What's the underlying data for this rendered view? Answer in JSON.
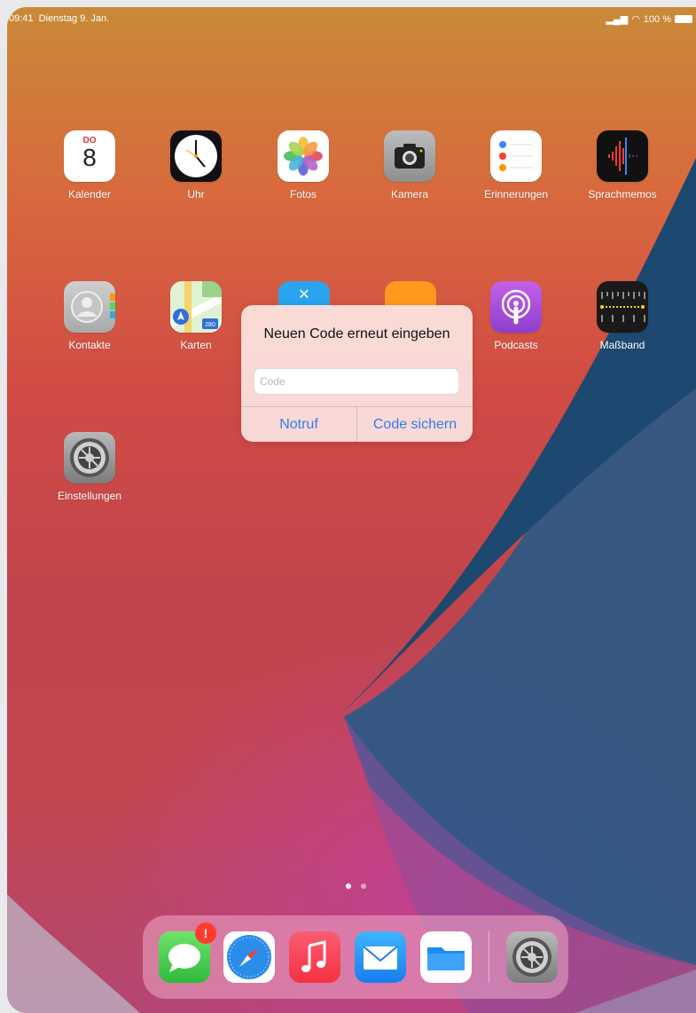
{
  "status_bar": {
    "time": "09:41",
    "date": "Dienstag 9. Jan.",
    "battery": "100 %"
  },
  "apps": [
    {
      "label": "Kalender",
      "icon": "calendar-icon",
      "weekday": "DO",
      "day": "8"
    },
    {
      "label": "Uhr",
      "icon": "clock-icon"
    },
    {
      "label": "Fotos",
      "icon": "photos-icon"
    },
    {
      "label": "Kamera",
      "icon": "camera-icon"
    },
    {
      "label": "Erinnerungen",
      "icon": "reminders-icon"
    },
    {
      "label": "Sprachmemos",
      "icon": "voice-memos-icon"
    },
    {
      "label": "Kontakte",
      "icon": "contacts-icon"
    },
    {
      "label": "Karten",
      "icon": "maps-icon",
      "route": "280"
    },
    {
      "label": "Podcasts",
      "icon": "podcasts-icon"
    },
    {
      "label": "Maßband",
      "icon": "measure-icon"
    },
    {
      "label": "Einstellungen",
      "icon": "settings-icon"
    }
  ],
  "page_indicator": {
    "pages": 2,
    "current": 1
  },
  "dock": {
    "items": [
      "messages-icon",
      "safari-icon",
      "music-icon",
      "mail-icon",
      "files-icon",
      "settings-icon"
    ],
    "messages_badge": "!"
  },
  "alert": {
    "title": "Neuen Code erneut eingeben",
    "input_placeholder": "Code",
    "input_value": "",
    "buttons": {
      "left": "Notruf",
      "right": "Code sichern"
    }
  },
  "colors": {
    "accent": "#2f7bf6",
    "badge": "#ff3b30"
  }
}
